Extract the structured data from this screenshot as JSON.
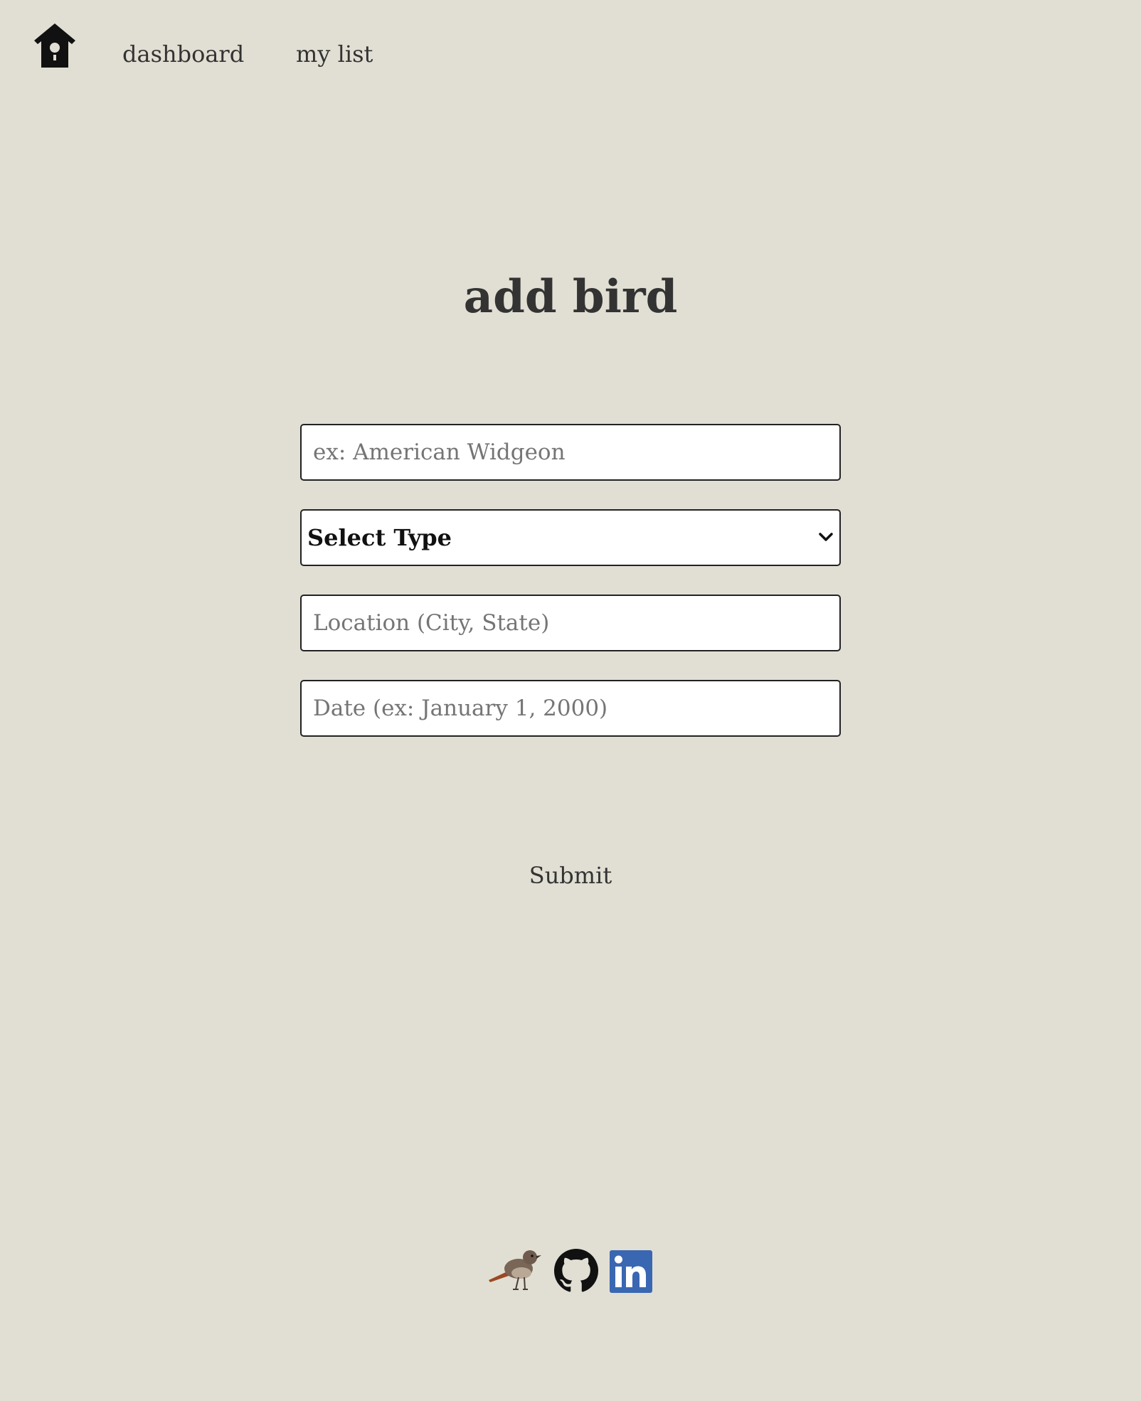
{
  "nav": {
    "home_icon": "birdhouse-icon",
    "dashboard_label": "dashboard",
    "my_list_label": "my list"
  },
  "page": {
    "title": "add bird"
  },
  "form": {
    "name_placeholder": "ex: American Widgeon",
    "type_select_value": "Select Type",
    "location_placeholder": "Location (City, State)",
    "date_placeholder": "Date (ex: January 1, 2000)",
    "submit_label": "Submit"
  },
  "footer": {
    "icons": [
      "bird-icon",
      "github-icon",
      "linkedin-icon"
    ]
  },
  "colors": {
    "background": "#e1dfd3",
    "text": "#333333",
    "linkedin_blue": "#3a67b2"
  }
}
